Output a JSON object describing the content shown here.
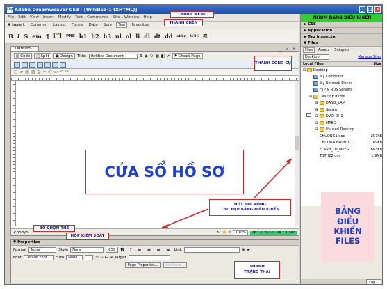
{
  "window": {
    "title": "Adobe Dreamweaver CS3 - [Untitled-1 (XHTML)]",
    "controls": [
      "_",
      "□",
      "×"
    ]
  },
  "menubar": {
    "items": [
      "File",
      "Edit",
      "View",
      "Insert",
      "Modify",
      "Text",
      "Commands",
      "Site",
      "Window",
      "Help"
    ]
  },
  "insertbar": {
    "title": "▼ Insert",
    "tabs": [
      "Common",
      "Layout",
      "Forms",
      "Data",
      "Spry",
      "Text",
      "Favorites"
    ]
  },
  "formatbar": {
    "items": [
      "B",
      "I",
      "S",
      "em",
      "¶",
      "[\"\"]",
      "PRE",
      "h1",
      "h2",
      "h3",
      "ul",
      "ol",
      "li",
      "dl",
      "dt",
      "dd",
      "abbr",
      "W3C",
      "吧·"
    ]
  },
  "document": {
    "tab_label": "Untitled-1",
    "view_buttons": [
      "Code",
      "Split",
      "Design"
    ],
    "title_label": "Title:",
    "title_value": "Untitled Document",
    "check_page": "Check Page",
    "status_tag": "<body>",
    "zoom": "100%",
    "dimensions": "763 x 353 ~ 1K / 1 sec"
  },
  "properties": {
    "title": "▼ Properties",
    "format_label": "Format",
    "format_value": "None",
    "style_label": "Style",
    "style_value": "None",
    "css_label": "CSS",
    "link_label": "Link",
    "font_label": "Font",
    "font_value": "Default Font",
    "size_label": "Size",
    "size_value": "None",
    "target_label": "Target",
    "page_properties": "Page Properties...",
    "list_item": "List Item..."
  },
  "right_panel": {
    "sections": [
      "▶ CSS",
      "▶ Application",
      "▶ Tag Inspector",
      "▼ Files"
    ],
    "file_tabs": [
      "Files",
      "Assets",
      "Snippets"
    ],
    "site_select": "Desktop",
    "manage_sites": "Manage Sites",
    "col_local": "Local Files",
    "col_size": "Size",
    "tree": [
      {
        "label": "Desktop",
        "icon": "folder",
        "depth": 0,
        "size": ""
      },
      {
        "label": "My Computer",
        "icon": "pc",
        "depth": 1,
        "size": ""
      },
      {
        "label": "My Network Places",
        "icon": "pc",
        "depth": 1,
        "size": ""
      },
      {
        "label": "FTP & RDS Servers",
        "icon": "pc",
        "depth": 1,
        "size": ""
      },
      {
        "label": "Desktop items",
        "icon": "folder",
        "depth": 1,
        "size": ""
      },
      {
        "label": "DANG_LAM",
        "icon": "folder",
        "depth": 2,
        "size": ""
      },
      {
        "label": "dream",
        "icon": "folder",
        "depth": 2,
        "size": ""
      },
      {
        "label": "DVD_DI_1",
        "icon": "folder",
        "depth": 2,
        "size": ""
      },
      {
        "label": "MPEG",
        "icon": "folder",
        "depth": 2,
        "size": ""
      },
      {
        "label": "Unused Desktop ...",
        "icon": "folder",
        "depth": 2,
        "size": ""
      },
      {
        "label": "CHUONG1.doc",
        "icon": "doc",
        "depth": 2,
        "size": "257KB"
      },
      {
        "label": "CHUONG HAI MU...",
        "icon": "doc",
        "depth": 2,
        "size": "169KB"
      },
      {
        "label": "FLASH_TO_MPEG...",
        "icon": "doc",
        "depth": 2,
        "size": "683KB"
      },
      {
        "label": "TBTH22.doc",
        "icon": "doc",
        "depth": 2,
        "size": "1.9MB"
      }
    ],
    "log_button": "Log..."
  },
  "annotations": {
    "thanh_menu": "THANH MENU",
    "thanh_chen": "THANH CHÈN",
    "thanh_cong_cu": "THANH CÔNG CỤ",
    "nhom_bang": "NHÓM BẢNG ĐIỀU KHIỂN",
    "cua_so_ho_so": "CỬA SỔ HỒ SƠ",
    "nut_noi_rong": "NÚT NỚI RỘNG\nTHU HẸP BẢNG ĐIỀU KHIỂN",
    "bo_chon_the": "BỘ CHỌN THẺ",
    "hop_kiem_soat": "HỘP KIỂM SOÁT",
    "thanh_trang_thai": "THANH\nTRẠNG THÁI",
    "bang_dieu_khien_files": "BẢNG\nĐIỀU\nKHIỂN\nFILES"
  },
  "colors": {
    "title_blue": "#1e50a8",
    "callout_red": "#d02a2a",
    "annotation_blue": "#1e3fd6",
    "panel_green": "#33cc33",
    "files_pink": "#fadadd"
  }
}
